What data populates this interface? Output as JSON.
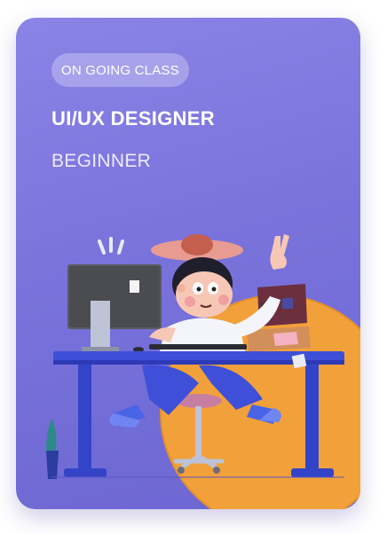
{
  "card": {
    "badge": "ON GOING CLASS",
    "title": "UI/UX DESIGNER",
    "level": "BEGINNER"
  },
  "colors": {
    "card_top": "#8a84e6",
    "card_bottom": "#6c66d2",
    "orange_circle": "#f2a03a",
    "desk_blue": "#3d4fd6",
    "chair_pink": "#c77ea1"
  }
}
